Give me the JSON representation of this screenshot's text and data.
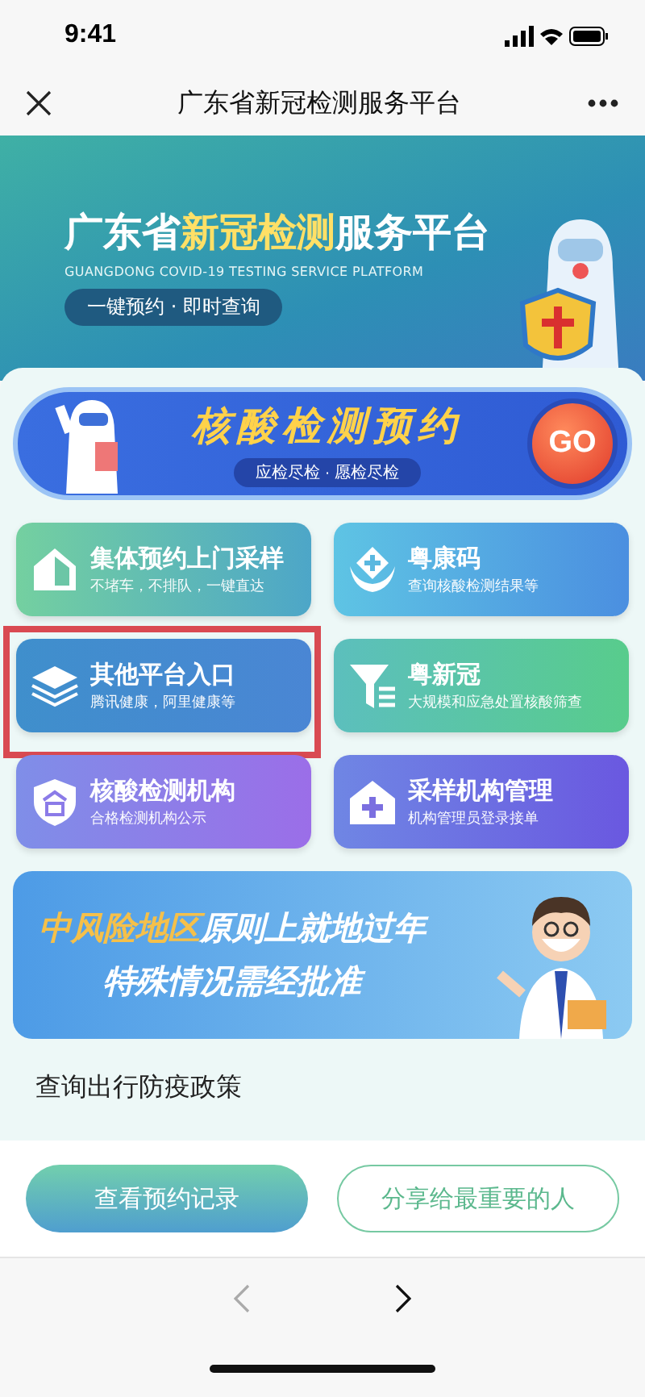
{
  "status_bar": {
    "time": "9:41"
  },
  "nav": {
    "title": "广东省新冠检测服务平台"
  },
  "hero": {
    "title_parts": [
      {
        "text": "广东省",
        "highlight": false
      },
      {
        "text": "新冠检测",
        "highlight": true
      },
      {
        "text": "服务平台",
        "highlight": false
      }
    ],
    "subtitle": "GUANGDONG COVID-19 TESTING SERVICE PLATFORM",
    "tagline": "一键预约 · 即时查询"
  },
  "booking": {
    "title": "核酸检测预约",
    "subtitle": "应检尽检 · 愿检尽检",
    "go": "GO"
  },
  "tiles": [
    {
      "kind": "house",
      "title": "集体预约上门采样",
      "desc": "不堵车，不排队，一键直达",
      "highlighted": false
    },
    {
      "kind": "hands",
      "title": "粤康码",
      "desc": "查询核酸检测结果等",
      "highlighted": false
    },
    {
      "kind": "layers",
      "title": "其他平台入口",
      "desc": "腾讯健康，阿里健康等",
      "highlighted": true
    },
    {
      "kind": "funnel",
      "title": "粤新冠",
      "desc": "大规模和应急处置核酸筛查",
      "highlighted": false
    },
    {
      "kind": "shield",
      "title": "核酸检测机构",
      "desc": "合格检测机构公示",
      "highlighted": false
    },
    {
      "kind": "clinic",
      "title": "采样机构管理",
      "desc": "机构管理员登录接单",
      "highlighted": false
    }
  ],
  "notice": {
    "lines": [
      [
        {
          "text": "中风险地区",
          "highlight": true
        },
        {
          "text": "原则上就地过年",
          "highlight": false
        }
      ],
      [
        {
          "text": "特殊情况需经批准",
          "highlight": false
        }
      ]
    ]
  },
  "section_title": "查询出行防疫政策",
  "actions": {
    "primary": "查看预约记录",
    "secondary": "分享给最重要的人"
  },
  "browser": {
    "back_disabled": true,
    "forward_disabled": false
  }
}
